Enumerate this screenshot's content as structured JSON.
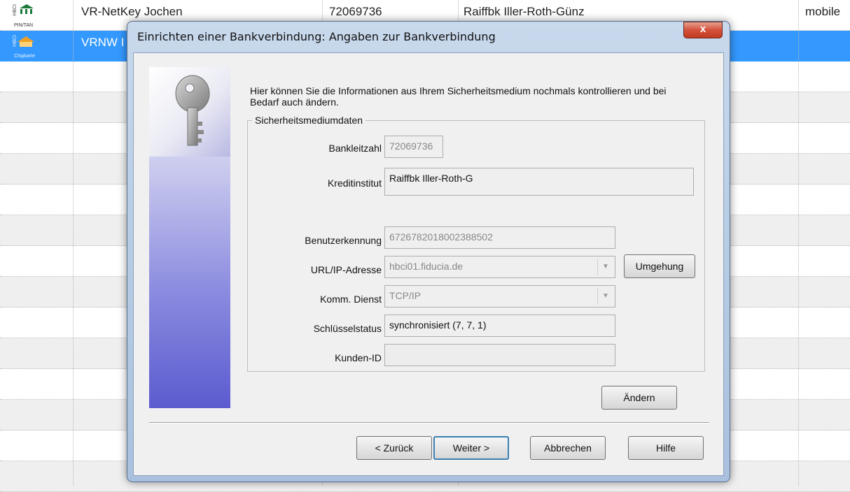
{
  "grid": {
    "row1": {
      "protocol_caption": "PIN/TAN",
      "protocol_side": "HBCI",
      "name": "VR-NetKey Jochen",
      "blz": "72069736",
      "bank": "Raiffbk Iller-Roth-Günz",
      "type": "mobile"
    },
    "row2": {
      "protocol_caption": "Chipkarte",
      "protocol_side": "HBCI",
      "name": "VRNW I"
    }
  },
  "dialog": {
    "title": "Einrichten einer Bankverbindung: Angaben zur Bankverbindung",
    "close_glyph": "x",
    "intro": "Hier können Sie die Informationen aus Ihrem Sicherheitsmedium nochmals kontrollieren und bei Bedarf auch ändern.",
    "group_title": "Sicherheitsmediumdaten",
    "fields": {
      "bankleitzahl": {
        "label": "Bankleitzahl",
        "value": "72069736"
      },
      "kreditinstitut": {
        "label": "Kreditinstitut",
        "value": "Raiffbk Iller-Roth-G"
      },
      "benutzerkennung": {
        "label": "Benutzerkennung",
        "value": "6726782018002388502"
      },
      "url": {
        "label": "URL/IP-Adresse",
        "value": "hbci01.fiducia.de"
      },
      "komm": {
        "label": "Komm. Dienst",
        "value": "TCP/IP"
      },
      "schluessel": {
        "label": "Schlüsselstatus",
        "value": "synchronisiert (7, 7, 1)"
      },
      "kunden": {
        "label": "Kunden-ID",
        "value": ""
      }
    },
    "buttons": {
      "umgehung": "Umgehung",
      "aendern": "Ändern",
      "zurueck": "< Zurück",
      "weiter": "Weiter >",
      "abbrechen": "Abbrechen",
      "hilfe": "Hilfe"
    },
    "colors": {
      "selection": "#3399ff",
      "close": "#c23a22",
      "default_border": "#3c7fb1"
    }
  }
}
